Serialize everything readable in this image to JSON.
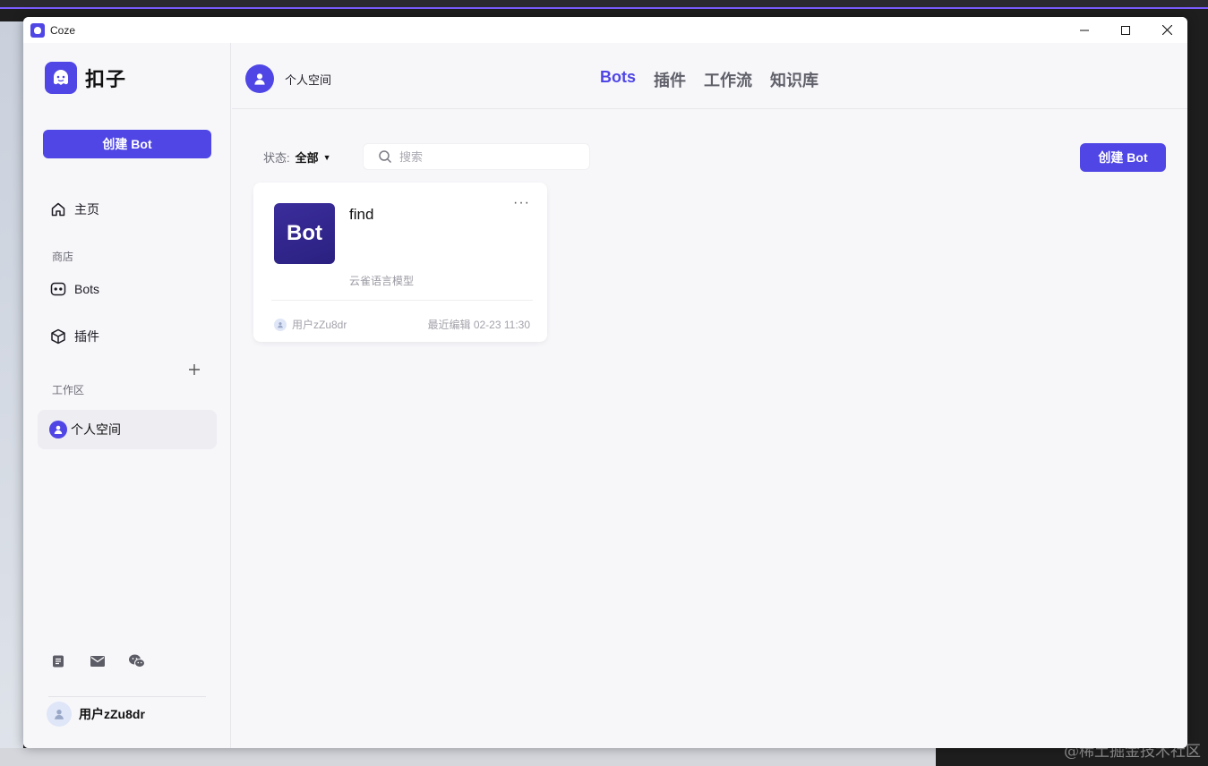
{
  "window": {
    "title": "Coze"
  },
  "brand": {
    "name": "扣子"
  },
  "sidebar": {
    "create_label": "创建 Bot",
    "home_label": "主页",
    "store_section": "商店",
    "store_items": [
      "Bots",
      "插件"
    ],
    "workspace_section": "工作区",
    "workspace_item": "个人空间",
    "user_name": "用户zZu8dr"
  },
  "header": {
    "space_name": "个人空间",
    "tabs": [
      "Bots",
      "插件",
      "工作流",
      "知识库"
    ],
    "active_tab": "Bots"
  },
  "toolbar": {
    "status_label": "状态:",
    "status_value": "全部",
    "search_placeholder": "搜索",
    "create_label": "创建 Bot"
  },
  "bots": [
    {
      "avatar_text": "Bot",
      "name": "find",
      "model": "云雀语言模型",
      "owner": "用户zZu8dr",
      "edited": "最近编辑 02-23 11:30"
    }
  ],
  "watermark": "@稀土掘金技术社区",
  "colors": {
    "accent": "#4f46e5",
    "background": "#f7f7fa",
    "bot_avatar": "#2f2590"
  }
}
